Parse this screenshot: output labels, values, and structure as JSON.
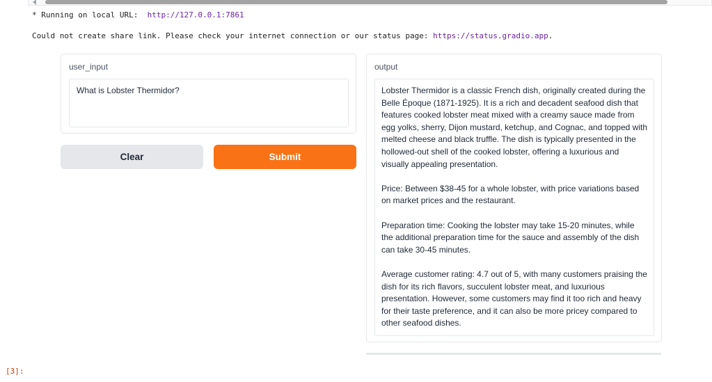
{
  "log": {
    "running_prefix": "* Running on local URL:  ",
    "local_url": "http://127.0.0.1:7861",
    "share_prefix": "Could not create share link. Please check your internet connection or our status page: ",
    "status_url": "https://status.gradio.app",
    "share_suffix": "."
  },
  "input_panel": {
    "label": "user_input",
    "value": "What is Lobster Thermidor?"
  },
  "buttons": {
    "clear_label": "Clear",
    "submit_label": "Submit"
  },
  "output_panel": {
    "label": "output",
    "paragraphs": [
      " Lobster Thermidor is a classic French dish, originally created during the Belle Époque (1871-1925). It is a rich and decadent seafood dish that features cooked lobster meat mixed with a creamy sauce made from egg yolks, sherry, Dijon mustard, ketchup, and Cognac, and topped with melted cheese and black truffle. The dish is typically presented in the hollowed-out shell of the cooked lobster, offering a luxurious and visually appealing presentation.",
      "Price: Between $38-45 for a whole lobster, with price variations based on market prices and the restaurant.",
      "Preparation time: Cooking the lobster may take 15-20 minutes, while the additional preparation time for the sauce and assembly of the dish can take 30-45 minutes.",
      "Average customer rating: 4.7 out of 5, with many customers praising the dish for its rich flavors, succulent lobster meat, and luxurious presentation. However, some customers may find it too rich and heavy for their taste preference, and it can also be more pricey compared to other seafood dishes."
    ]
  },
  "cell_prompt": "[3]:",
  "colors": {
    "submit": "#f97316",
    "clear": "#e5e7eb",
    "url": "#6b21a8",
    "prompt": "#c2410c"
  }
}
